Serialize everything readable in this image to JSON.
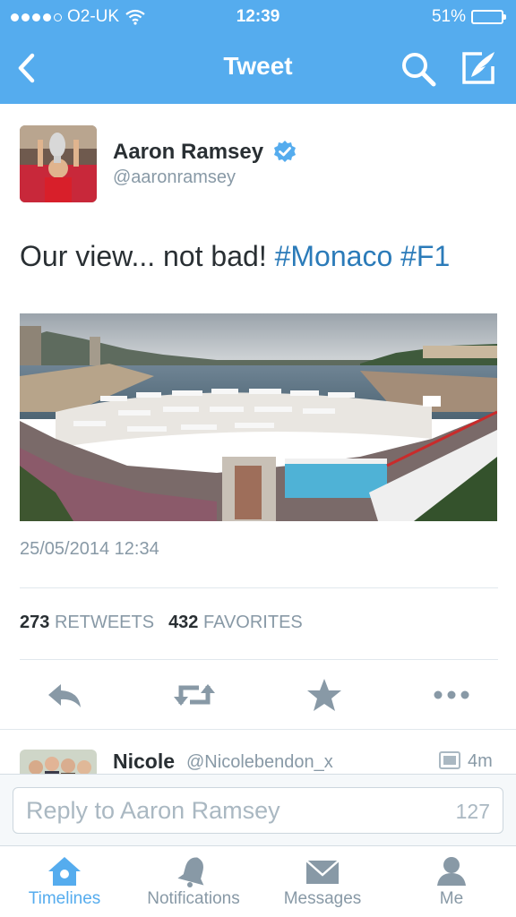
{
  "status_bar": {
    "carrier": "O2-UK",
    "time": "12:39",
    "battery": "51%",
    "battery_level": 0.51
  },
  "nav": {
    "title": "Tweet",
    "back_icon": "chevron-left-icon",
    "search_icon": "search-icon",
    "compose_icon": "compose-icon"
  },
  "tweet": {
    "display_name": "Aaron Ramsey",
    "handle": "@aaronramsey",
    "verified": true,
    "text_plain": "Our view... not bad! ",
    "hashtags": [
      "#Monaco",
      "#F1"
    ],
    "timestamp": "25/05/2014 12:34",
    "retweets_count": "273",
    "retweets_label": "RETWEETS",
    "favorites_count": "432",
    "favorites_label": "FAVORITES"
  },
  "actions": [
    "reply-icon",
    "retweet-icon",
    "favorite-icon",
    "more-icon"
  ],
  "reply": {
    "name": "Nicole",
    "handle": "@Nicolebendon_x",
    "time": "4m"
  },
  "composer": {
    "placeholder": "Reply to Aaron Ramsey",
    "char_count": "127"
  },
  "tabs": [
    {
      "label": "Timelines",
      "icon": "home-icon",
      "active": true
    },
    {
      "label": "Notifications",
      "icon": "bell-icon",
      "active": false
    },
    {
      "label": "Messages",
      "icon": "envelope-icon",
      "active": false
    },
    {
      "label": "Me",
      "icon": "person-icon",
      "active": false
    }
  ],
  "colors": {
    "brand": "#55acee",
    "hashtag": "#2b7bb9",
    "muted": "#8899a6",
    "text": "#292f33"
  }
}
